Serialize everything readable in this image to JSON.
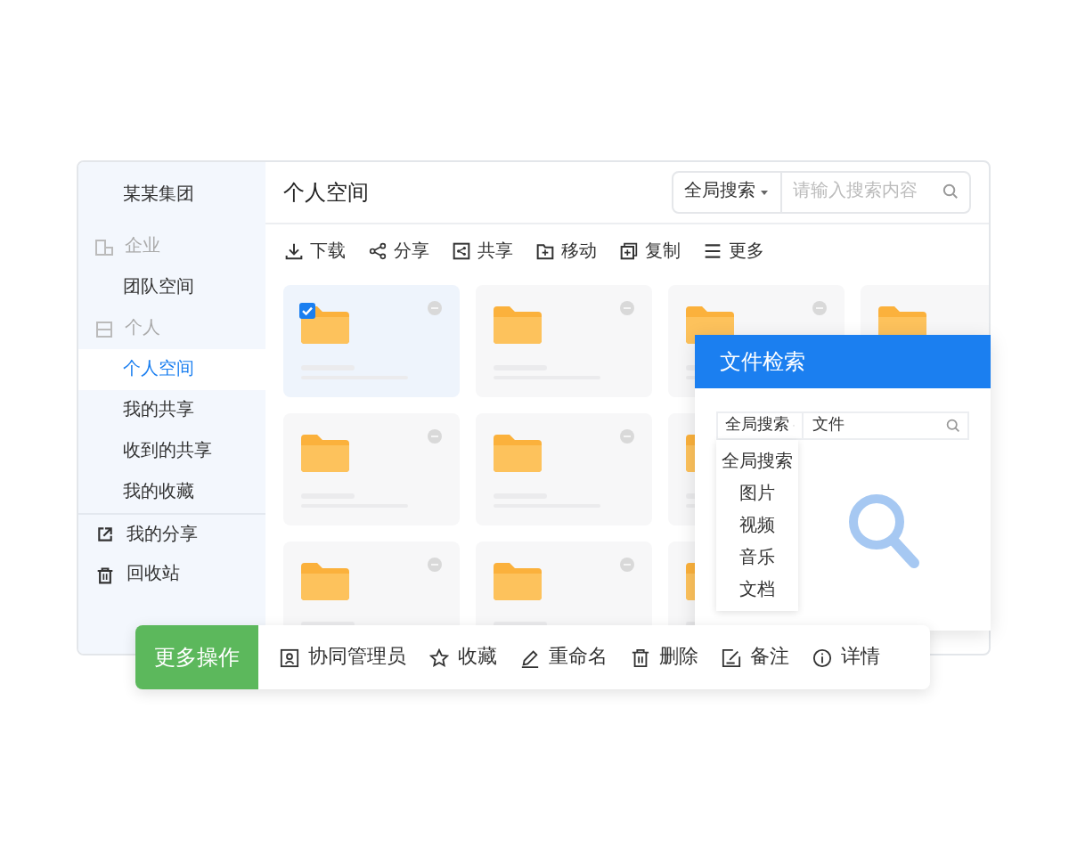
{
  "sidebar": {
    "title": "某某集团",
    "items": [
      {
        "kind": "group",
        "label": "企业"
      },
      {
        "kind": "item",
        "label": "团队空间",
        "selected": false
      },
      {
        "kind": "group",
        "label": "个人"
      },
      {
        "kind": "item",
        "label": "个人空间",
        "selected": true
      },
      {
        "kind": "item",
        "label": "我的共享",
        "selected": false
      },
      {
        "kind": "item",
        "label": "收到的共享",
        "selected": false
      },
      {
        "kind": "item",
        "label": "我的收藏",
        "selected": false
      },
      {
        "kind": "link",
        "label": "我的分享",
        "selected": false
      },
      {
        "kind": "link",
        "label": "回收站",
        "selected": false
      }
    ]
  },
  "header": {
    "title": "个人空间",
    "search_scope": "全局搜索",
    "search_placeholder": "请输入搜索内容"
  },
  "toolbar": [
    "下载",
    "分享",
    "共享",
    "移动",
    "复制",
    "更多"
  ],
  "file_rows": [
    [
      {
        "kind": "full",
        "selected": true
      },
      {
        "kind": "full",
        "selected": false
      },
      {
        "kind": "full",
        "selected": false
      },
      {
        "kind": "folder",
        "selected": false
      }
    ],
    [
      {
        "kind": "full",
        "selected": false
      },
      {
        "kind": "full",
        "selected": false
      },
      {
        "kind": "edge",
        "selected": false
      }
    ],
    [
      {
        "kind": "full",
        "selected": false
      },
      {
        "kind": "full",
        "selected": false
      },
      {
        "kind": "edge",
        "selected": false
      }
    ]
  ],
  "search_dialog": {
    "title": "文件检索",
    "scope": "全局搜索",
    "query": "文件",
    "options": [
      "全局搜索",
      "图片",
      "视频",
      "音乐",
      "文档"
    ]
  },
  "action_bar": {
    "label": "更多操作",
    "actions": [
      "协同管理员",
      "收藏",
      "重命名",
      "删除",
      "备注",
      "详情"
    ]
  }
}
